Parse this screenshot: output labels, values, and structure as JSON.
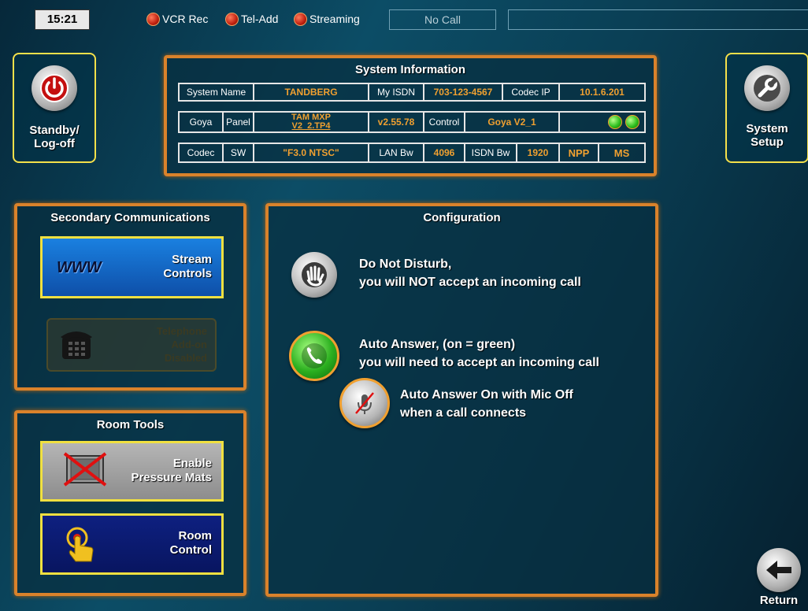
{
  "topbar": {
    "clock": "15:21",
    "indicators": [
      {
        "label": "VCR Rec"
      },
      {
        "label": "Tel-Add"
      },
      {
        "label": "Streaming"
      }
    ],
    "call_status": "No Call"
  },
  "standby": {
    "line1": "Standby/",
    "line2": "Log-off"
  },
  "system_setup": {
    "line1": "System",
    "line2": "Setup"
  },
  "system_info": {
    "title": "System Information",
    "row1": {
      "system_name_label": "System Name",
      "system_name": "TANDBERG",
      "my_isdn_label": "My ISDN",
      "my_isdn": "703-123-4567",
      "codec_ip_label": "Codec IP",
      "codec_ip": "10.1.6.201"
    },
    "row2": {
      "goya_label": "Goya",
      "panel_label": "Panel",
      "panel_line1": "TAM MXP",
      "panel_line2": "V2_2.TP4",
      "panel_version": "v2.55.78",
      "control_label": "Control",
      "control_value": "Goya V2_1"
    },
    "row3": {
      "codec_label": "Codec",
      "sw_label": "SW",
      "sw_value": "\"F3.0 NTSC\"",
      "lan_bw_label": "LAN Bw",
      "lan_bw": "4096",
      "isdn_bw_label": "ISDN Bw",
      "isdn_bw": "1920",
      "npp": "NPP",
      "ms": "MS"
    }
  },
  "secondary": {
    "title": "Secondary Communications",
    "stream": {
      "icon_text": "WWW",
      "line1": "Stream",
      "line2": "Controls"
    },
    "telephone": {
      "line1": "Telephone",
      "line2": "Add-on",
      "line3": "Disabled"
    }
  },
  "room_tools": {
    "title": "Room Tools",
    "pressure": {
      "line1": "Enable",
      "line2": "Pressure Mats"
    },
    "room_control": {
      "line1": "Room",
      "line2": "Control"
    }
  },
  "configuration": {
    "title": "Configuration",
    "dnd": {
      "line1": "Do Not Disturb,",
      "line2": "you will NOT accept an incoming call"
    },
    "auto_answer": {
      "line1": "Auto Answer, (on = green)",
      "line2": "you will need to accept an incoming call"
    },
    "mic_off": {
      "line1": "Auto Answer On with Mic Off",
      "line2": "when a call connects"
    }
  },
  "return": {
    "label": "Return"
  },
  "colors": {
    "panel_border": "#d9822b",
    "button_border": "#f0e040",
    "value_orange": "#f0a030",
    "stream_blue": "#1468c8",
    "room_navy": "#0a1a6e"
  }
}
